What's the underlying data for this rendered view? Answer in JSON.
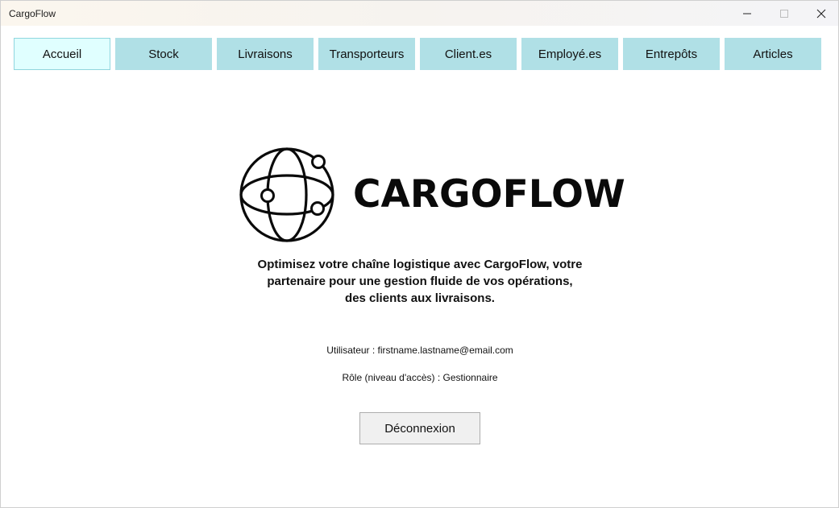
{
  "window": {
    "title": "CargoFlow"
  },
  "nav": {
    "tabs": [
      {
        "label": "Accueil",
        "active": true
      },
      {
        "label": "Stock",
        "active": false
      },
      {
        "label": "Livraisons",
        "active": false
      },
      {
        "label": "Transporteurs",
        "active": false
      },
      {
        "label": "Client.es",
        "active": false
      },
      {
        "label": "Employé.es",
        "active": false
      },
      {
        "label": "Entrepôts",
        "active": false
      },
      {
        "label": "Articles",
        "active": false
      }
    ]
  },
  "branding": {
    "logo_icon": "globe-network-icon",
    "name": "CARGOFLOW",
    "tagline": [
      "Optimisez votre chaîne logistique avec CargoFlow, votre",
      "partenaire pour une gestion fluide de vos opérations,",
      "des clients aux livraisons."
    ]
  },
  "user": {
    "user_line": "Utilisateur : firstname.lastname@email.com",
    "role_line": "Rôle (niveau d'accès) : Gestionnaire"
  },
  "actions": {
    "logout_label": "Déconnexion"
  },
  "colors": {
    "tab_bg": "#b0e0e6",
    "tab_active_bg": "#e0ffff",
    "button_bg": "#f0f0f0"
  }
}
